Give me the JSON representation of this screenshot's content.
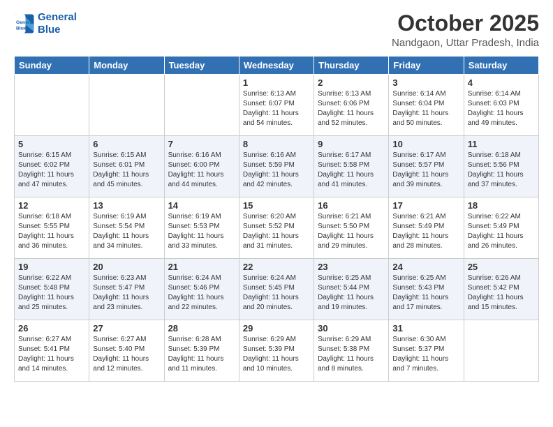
{
  "logo": {
    "line1": "General",
    "line2": "Blue"
  },
  "title": "October 2025",
  "location": "Nandgaon, Uttar Pradesh, India",
  "days_of_week": [
    "Sunday",
    "Monday",
    "Tuesday",
    "Wednesday",
    "Thursday",
    "Friday",
    "Saturday"
  ],
  "weeks": [
    [
      {
        "day": "",
        "info": ""
      },
      {
        "day": "",
        "info": ""
      },
      {
        "day": "",
        "info": ""
      },
      {
        "day": "1",
        "info": "Sunrise: 6:13 AM\nSunset: 6:07 PM\nDaylight: 11 hours\nand 54 minutes."
      },
      {
        "day": "2",
        "info": "Sunrise: 6:13 AM\nSunset: 6:06 PM\nDaylight: 11 hours\nand 52 minutes."
      },
      {
        "day": "3",
        "info": "Sunrise: 6:14 AM\nSunset: 6:04 PM\nDaylight: 11 hours\nand 50 minutes."
      },
      {
        "day": "4",
        "info": "Sunrise: 6:14 AM\nSunset: 6:03 PM\nDaylight: 11 hours\nand 49 minutes."
      }
    ],
    [
      {
        "day": "5",
        "info": "Sunrise: 6:15 AM\nSunset: 6:02 PM\nDaylight: 11 hours\nand 47 minutes."
      },
      {
        "day": "6",
        "info": "Sunrise: 6:15 AM\nSunset: 6:01 PM\nDaylight: 11 hours\nand 45 minutes."
      },
      {
        "day": "7",
        "info": "Sunrise: 6:16 AM\nSunset: 6:00 PM\nDaylight: 11 hours\nand 44 minutes."
      },
      {
        "day": "8",
        "info": "Sunrise: 6:16 AM\nSunset: 5:59 PM\nDaylight: 11 hours\nand 42 minutes."
      },
      {
        "day": "9",
        "info": "Sunrise: 6:17 AM\nSunset: 5:58 PM\nDaylight: 11 hours\nand 41 minutes."
      },
      {
        "day": "10",
        "info": "Sunrise: 6:17 AM\nSunset: 5:57 PM\nDaylight: 11 hours\nand 39 minutes."
      },
      {
        "day": "11",
        "info": "Sunrise: 6:18 AM\nSunset: 5:56 PM\nDaylight: 11 hours\nand 37 minutes."
      }
    ],
    [
      {
        "day": "12",
        "info": "Sunrise: 6:18 AM\nSunset: 5:55 PM\nDaylight: 11 hours\nand 36 minutes."
      },
      {
        "day": "13",
        "info": "Sunrise: 6:19 AM\nSunset: 5:54 PM\nDaylight: 11 hours\nand 34 minutes."
      },
      {
        "day": "14",
        "info": "Sunrise: 6:19 AM\nSunset: 5:53 PM\nDaylight: 11 hours\nand 33 minutes."
      },
      {
        "day": "15",
        "info": "Sunrise: 6:20 AM\nSunset: 5:52 PM\nDaylight: 11 hours\nand 31 minutes."
      },
      {
        "day": "16",
        "info": "Sunrise: 6:21 AM\nSunset: 5:50 PM\nDaylight: 11 hours\nand 29 minutes."
      },
      {
        "day": "17",
        "info": "Sunrise: 6:21 AM\nSunset: 5:49 PM\nDaylight: 11 hours\nand 28 minutes."
      },
      {
        "day": "18",
        "info": "Sunrise: 6:22 AM\nSunset: 5:49 PM\nDaylight: 11 hours\nand 26 minutes."
      }
    ],
    [
      {
        "day": "19",
        "info": "Sunrise: 6:22 AM\nSunset: 5:48 PM\nDaylight: 11 hours\nand 25 minutes."
      },
      {
        "day": "20",
        "info": "Sunrise: 6:23 AM\nSunset: 5:47 PM\nDaylight: 11 hours\nand 23 minutes."
      },
      {
        "day": "21",
        "info": "Sunrise: 6:24 AM\nSunset: 5:46 PM\nDaylight: 11 hours\nand 22 minutes."
      },
      {
        "day": "22",
        "info": "Sunrise: 6:24 AM\nSunset: 5:45 PM\nDaylight: 11 hours\nand 20 minutes."
      },
      {
        "day": "23",
        "info": "Sunrise: 6:25 AM\nSunset: 5:44 PM\nDaylight: 11 hours\nand 19 minutes."
      },
      {
        "day": "24",
        "info": "Sunrise: 6:25 AM\nSunset: 5:43 PM\nDaylight: 11 hours\nand 17 minutes."
      },
      {
        "day": "25",
        "info": "Sunrise: 6:26 AM\nSunset: 5:42 PM\nDaylight: 11 hours\nand 15 minutes."
      }
    ],
    [
      {
        "day": "26",
        "info": "Sunrise: 6:27 AM\nSunset: 5:41 PM\nDaylight: 11 hours\nand 14 minutes."
      },
      {
        "day": "27",
        "info": "Sunrise: 6:27 AM\nSunset: 5:40 PM\nDaylight: 11 hours\nand 12 minutes."
      },
      {
        "day": "28",
        "info": "Sunrise: 6:28 AM\nSunset: 5:39 PM\nDaylight: 11 hours\nand 11 minutes."
      },
      {
        "day": "29",
        "info": "Sunrise: 6:29 AM\nSunset: 5:39 PM\nDaylight: 11 hours\nand 10 minutes."
      },
      {
        "day": "30",
        "info": "Sunrise: 6:29 AM\nSunset: 5:38 PM\nDaylight: 11 hours\nand 8 minutes."
      },
      {
        "day": "31",
        "info": "Sunrise: 6:30 AM\nSunset: 5:37 PM\nDaylight: 11 hours\nand 7 minutes."
      },
      {
        "day": "",
        "info": ""
      }
    ]
  ]
}
